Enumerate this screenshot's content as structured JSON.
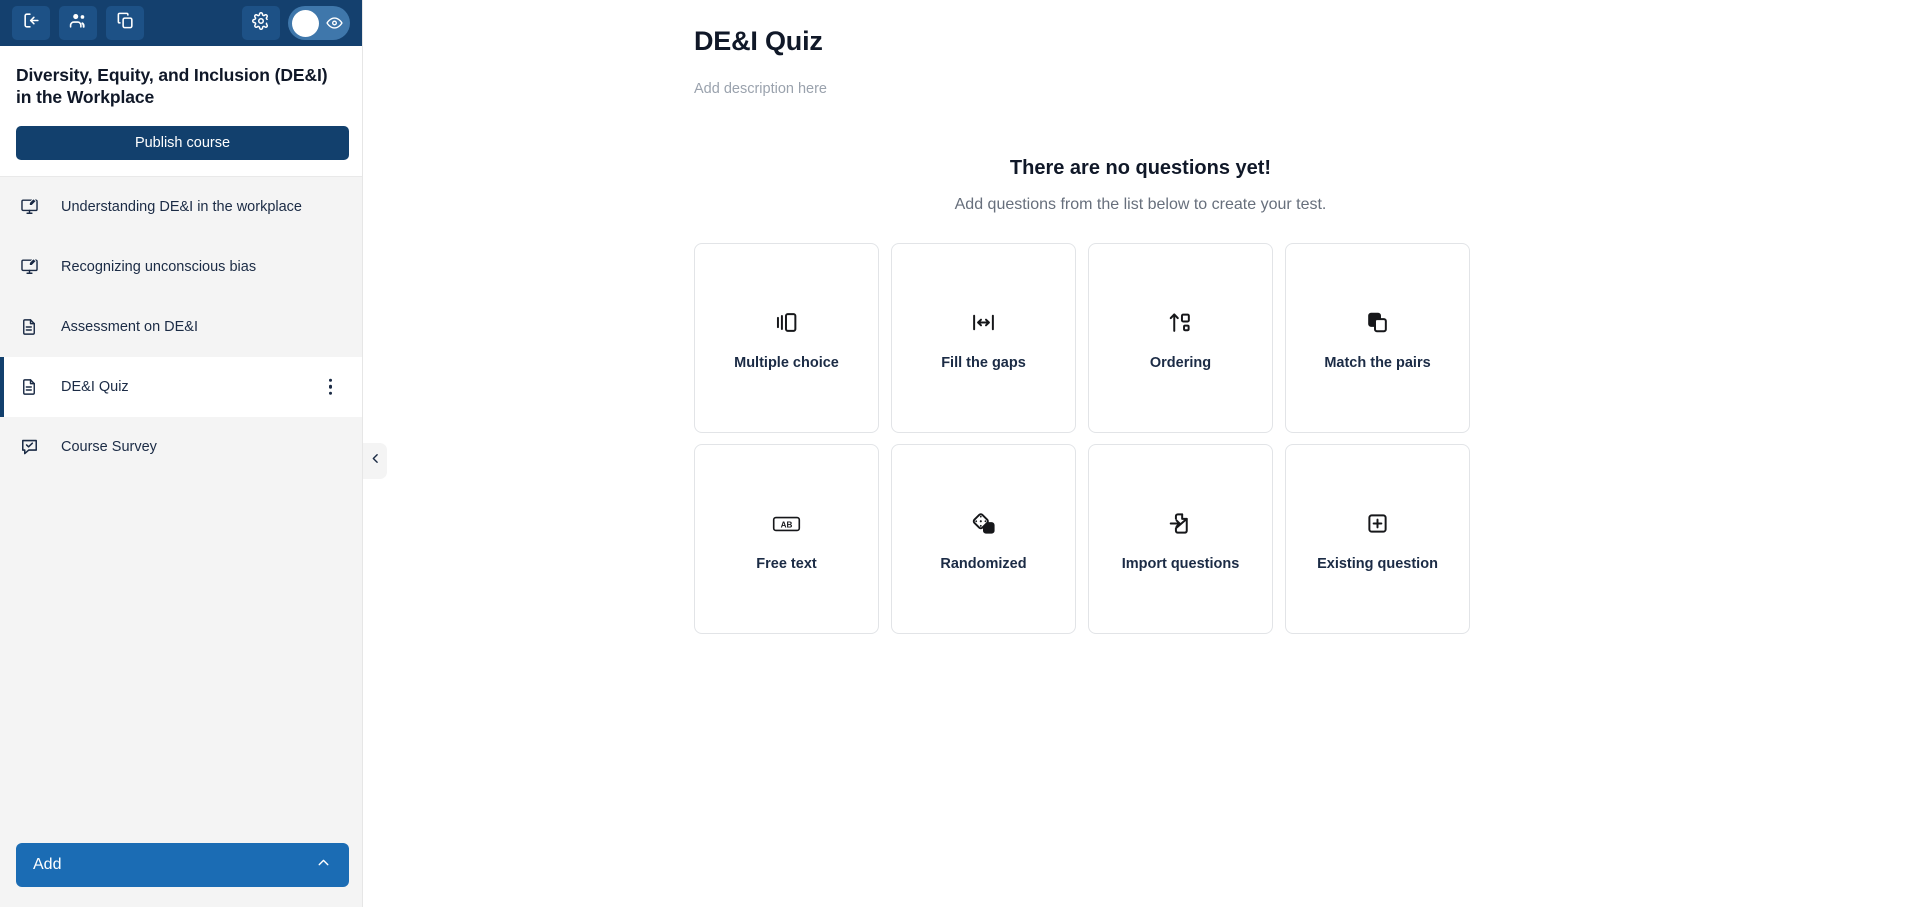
{
  "topbar": {
    "buttons": [
      {
        "name": "exit-course-button",
        "icon": "exit-icon"
      },
      {
        "name": "manage-learners-button",
        "icon": "users-icon"
      },
      {
        "name": "duplicate-course-button",
        "icon": "copy-icon"
      }
    ],
    "settings": {
      "name": "settings-button",
      "icon": "gear-icon"
    },
    "preview_toggle": {
      "name": "preview-toggle",
      "icon": "eye-icon",
      "state": "off"
    }
  },
  "sidebar": {
    "course_title": "Diversity, Equity, and Inclusion (DE&I) in the Workplace",
    "publish_label": "Publish course",
    "add_label": "Add",
    "add_chevron": "chevron-up-icon",
    "collapse_icon": "chevron-left-icon",
    "items": [
      {
        "label": "Understanding DE&I in the workplace",
        "icon": "presentation-lesson-icon",
        "active": false
      },
      {
        "label": "Recognizing unconscious bias",
        "icon": "presentation-lesson-icon",
        "active": false
      },
      {
        "label": "Assessment on DE&I",
        "icon": "document-icon",
        "active": false
      },
      {
        "label": "DE&I Quiz",
        "icon": "document-icon",
        "active": true
      },
      {
        "label": "Course Survey",
        "icon": "survey-icon",
        "active": false
      }
    ]
  },
  "main": {
    "title": "DE&I Quiz",
    "description_placeholder": "Add description here",
    "empty_heading": "There are no questions yet!",
    "empty_subheading": "Add questions from the list below to create your test.",
    "question_types": [
      {
        "label": "Multiple choice",
        "icon": "multiple-choice-icon"
      },
      {
        "label": "Fill the gaps",
        "icon": "fill-the-gaps-icon"
      },
      {
        "label": "Ordering",
        "icon": "ordering-icon"
      },
      {
        "label": "Match the pairs",
        "icon": "match-pairs-icon"
      },
      {
        "label": "Free text",
        "icon": "free-text-ab-icon"
      },
      {
        "label": "Randomized",
        "icon": "dice-icon"
      },
      {
        "label": "Import questions",
        "icon": "import-file-icon"
      },
      {
        "label": "Existing question",
        "icon": "plus-box-icon"
      }
    ]
  },
  "colors": {
    "header_navy": "#14406e",
    "publish_navy": "#12406d",
    "add_blue": "#1b6cb4",
    "sidebar_gray": "#f4f4f4",
    "card_border": "#e2e4e7"
  }
}
